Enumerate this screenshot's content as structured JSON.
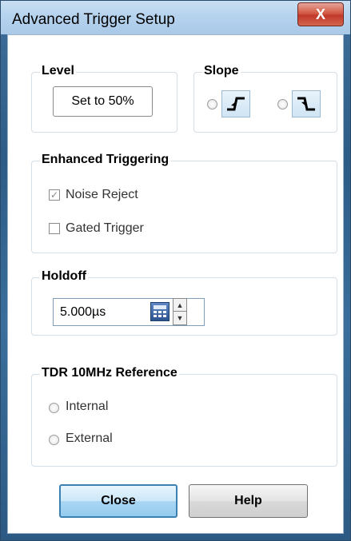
{
  "window": {
    "title": "Advanced Trigger Setup",
    "close_glyph": "X"
  },
  "level": {
    "legend": "Level",
    "set50_label": "Set to 50%"
  },
  "slope": {
    "legend": "Slope",
    "rising_icon": "rising-edge-icon",
    "falling_icon": "falling-edge-icon"
  },
  "enhanced": {
    "legend": "Enhanced Triggering",
    "noise_reject": {
      "label": "Noise Reject",
      "checked": true,
      "enabled": false
    },
    "gated_trigger": {
      "label": "Gated Trigger",
      "checked": false
    }
  },
  "holdoff": {
    "legend": "Holdoff",
    "value": "5.000µs",
    "calc_icon": "calculator-icon"
  },
  "tdr": {
    "legend": "TDR 10MHz Reference",
    "options": [
      {
        "label": "Internal"
      },
      {
        "label": "External"
      }
    ]
  },
  "footer": {
    "close_label": "Close",
    "help_label": "Help"
  },
  "colors": {
    "accent": "#3c7fb1",
    "title_bg": "#b6d3ee",
    "close_red": "#c0392b"
  }
}
